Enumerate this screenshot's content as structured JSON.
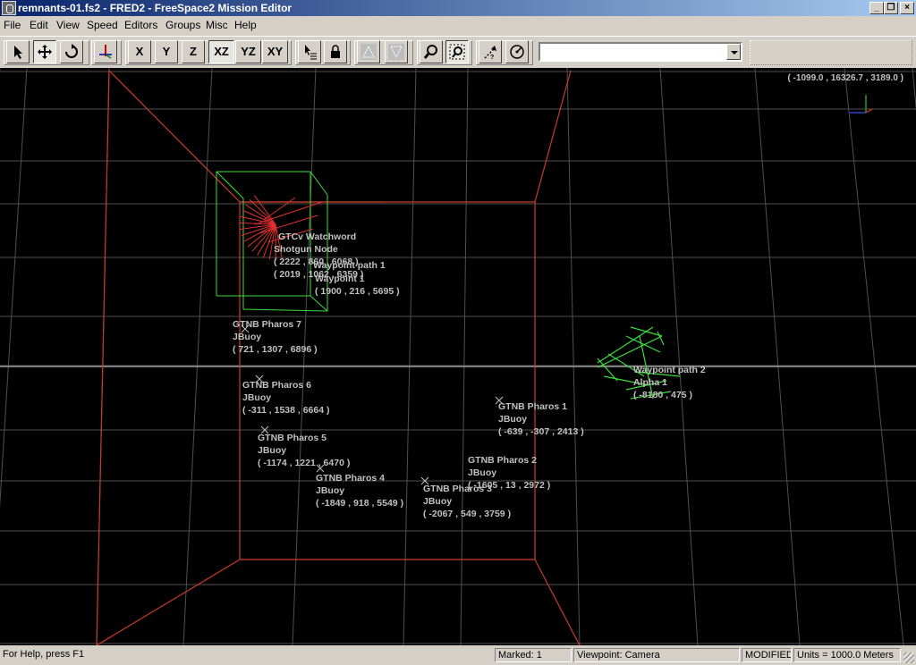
{
  "window": {
    "title": "remnants-01.fs2 - FRED2 - FreeSpace2 Mission Editor"
  },
  "menu": [
    {
      "name": "menu-file",
      "label": "File"
    },
    {
      "name": "menu-edit",
      "label": "Edit"
    },
    {
      "name": "menu-view",
      "label": "View"
    },
    {
      "name": "menu-speed",
      "label": "Speed"
    },
    {
      "name": "menu-editors",
      "label": "Editors"
    },
    {
      "name": "menu-groups",
      "label": "Groups"
    },
    {
      "name": "menu-misc",
      "label": "Misc"
    },
    {
      "name": "menu-help",
      "label": "Help"
    }
  ],
  "toolbar": {
    "axis_x": "X",
    "axis_y": "Y",
    "axis_z": "Z",
    "plane_xz": "XZ",
    "plane_yz": "YZ",
    "plane_xy": "XY",
    "combo_value": ""
  },
  "viewport": {
    "camera_coords": "( -1099.0 , 16326.7 , 3189.0 )",
    "labels": [
      {
        "name": "label-gtcv-watchword",
        "lines": [
          "GTCv Watchword"
        ]
      },
      {
        "name": "label-overlapping-1",
        "lines": [
          "Shotgun Node"
        ]
      },
      {
        "name": "label-overlapping-2",
        "lines": [
          "( 2222 , 860 , 6068 )"
        ]
      },
      {
        "name": "label-waypoint-path-1",
        "lines": [
          "Waypoint path 1"
        ]
      },
      {
        "name": "label-waypoint-1-coords",
        "lines": [
          "( 2019 , 1062 , 6359 )"
        ]
      },
      {
        "name": "label-waypoint-1",
        "lines": [
          "Waypoint 1",
          "( 1900 , 216 , 5695 )"
        ]
      },
      {
        "name": "label-pharos-7",
        "lines": [
          "GTNB Pharos 7",
          "JBuoy",
          "( 721 , 1307 , 6896 )"
        ]
      },
      {
        "name": "label-pharos-6",
        "lines": [
          "GTNB Pharos 6",
          "JBuoy",
          "( -311 , 1538 , 6664 )"
        ]
      },
      {
        "name": "label-pharos-5",
        "lines": [
          "GTNB Pharos 5",
          "JBuoy",
          "( -1174 , 1221 , 6470 )"
        ]
      },
      {
        "name": "label-pharos-4",
        "lines": [
          "GTNB Pharos 4",
          "JBuoy",
          "( -1849 , 918 , 5549 )"
        ]
      },
      {
        "name": "label-pharos-3",
        "lines": [
          "GTNB Pharos 3",
          "JBuoy",
          "( -2067 , 549 , 3759 )"
        ]
      },
      {
        "name": "label-pharos-2",
        "lines": [
          "GTNB Pharos 2",
          "JBuoy",
          "( -1605 , 13 , 2972 )"
        ]
      },
      {
        "name": "label-pharos-1",
        "lines": [
          "GTNB Pharos 1",
          "JBuoy",
          "( -639 , -307 , 2413 )"
        ]
      },
      {
        "name": "label-waypoint-path-2",
        "lines": [
          "Waypoint path 2"
        ]
      },
      {
        "name": "label-cluster-right",
        "lines": [
          "Alpha 1",
          "( -8180 , 475 )"
        ]
      }
    ]
  },
  "status": {
    "help": "For Help, press F1",
    "marked": "Marked: 1",
    "viewpoint": "Viewpoint: Camera",
    "modified": "MODIFIED",
    "units": "Units = 1000.0 Meters"
  },
  "colors": {
    "grid": "#505050",
    "red_box": "#c83c28",
    "green_ship": "#3cdc3c",
    "label": "#c0c0c0"
  }
}
